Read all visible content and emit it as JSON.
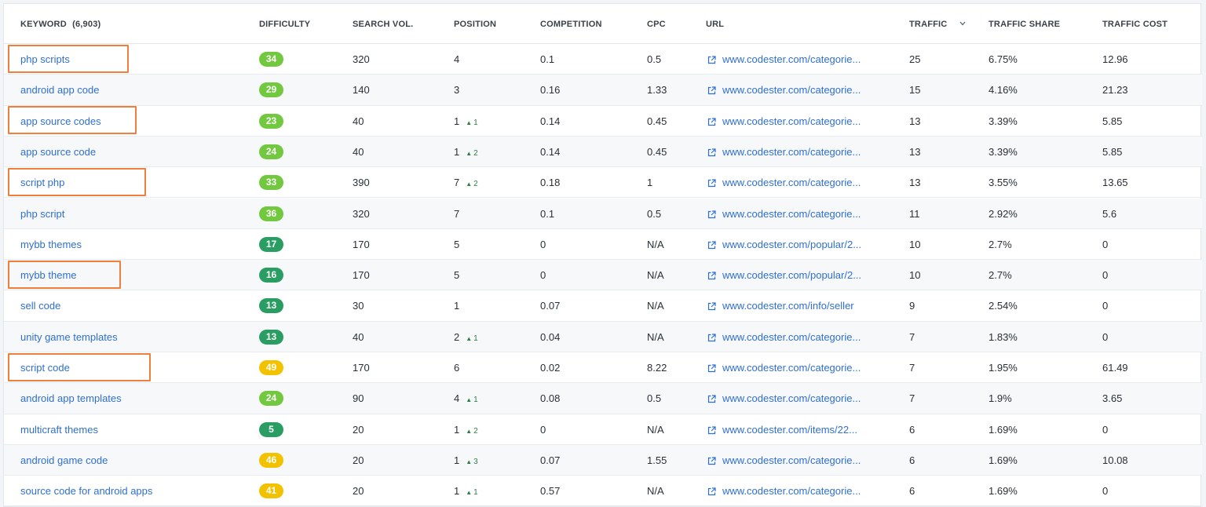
{
  "colors": {
    "keyword_link": "#2f6fd1",
    "difficulty_green_light": "#72c83f",
    "difficulty_green_dark": "#2a9d63",
    "difficulty_yellow": "#f2c200",
    "highlight_orange": "#f07f3c"
  },
  "columns": {
    "keyword": "KEYWORD",
    "keyword_count": "(6,903)",
    "difficulty": "DIFFICULTY",
    "search_vol": "SEARCH VOL.",
    "position": "POSITION",
    "competition": "COMPETITION",
    "cpc": "CPC",
    "url": "URL",
    "traffic": "TRAFFIC",
    "traffic_share": "TRAFFIC SHARE",
    "traffic_cost": "TRAFFIC COST"
  },
  "sort_icon": "chevron-down-icon",
  "rows": [
    {
      "keyword": "php scripts",
      "difficulty": "34",
      "diff_level": "light",
      "volume": "320",
      "position": "4",
      "change": "",
      "competition": "0.1",
      "cpc": "0.5",
      "url": "www.codester.com/categorie...",
      "traffic": "25",
      "share": "6.75%",
      "cost": "12.96",
      "highlighted": true
    },
    {
      "keyword": "android app code",
      "difficulty": "29",
      "diff_level": "light",
      "volume": "140",
      "position": "3",
      "change": "",
      "competition": "0.16",
      "cpc": "1.33",
      "url": "www.codester.com/categorie...",
      "traffic": "15",
      "share": "4.16%",
      "cost": "21.23",
      "highlighted": false
    },
    {
      "keyword": "app source codes",
      "difficulty": "23",
      "diff_level": "light",
      "volume": "40",
      "position": "1",
      "change": "1",
      "competition": "0.14",
      "cpc": "0.45",
      "url": "www.codester.com/categorie...",
      "traffic": "13",
      "share": "3.39%",
      "cost": "5.85",
      "highlighted": true
    },
    {
      "keyword": "app source code",
      "difficulty": "24",
      "diff_level": "light",
      "volume": "40",
      "position": "1",
      "change": "2",
      "competition": "0.14",
      "cpc": "0.45",
      "url": "www.codester.com/categorie...",
      "traffic": "13",
      "share": "3.39%",
      "cost": "5.85",
      "highlighted": false
    },
    {
      "keyword": "script php",
      "difficulty": "33",
      "diff_level": "light",
      "volume": "390",
      "position": "7",
      "change": "2",
      "competition": "0.18",
      "cpc": "1",
      "url": "www.codester.com/categorie...",
      "traffic": "13",
      "share": "3.55%",
      "cost": "13.65",
      "highlighted": true
    },
    {
      "keyword": "php script",
      "difficulty": "36",
      "diff_level": "light",
      "volume": "320",
      "position": "7",
      "change": "",
      "competition": "0.1",
      "cpc": "0.5",
      "url": "www.codester.com/categorie...",
      "traffic": "11",
      "share": "2.92%",
      "cost": "5.6",
      "highlighted": false
    },
    {
      "keyword": "mybb themes",
      "difficulty": "17",
      "diff_level": "dark",
      "volume": "170",
      "position": "5",
      "change": "",
      "competition": "0",
      "cpc": "N/A",
      "url": "www.codester.com/popular/2...",
      "traffic": "10",
      "share": "2.7%",
      "cost": "0",
      "highlighted": false
    },
    {
      "keyword": "mybb theme",
      "difficulty": "16",
      "diff_level": "dark",
      "volume": "170",
      "position": "5",
      "change": "",
      "competition": "0",
      "cpc": "N/A",
      "url": "www.codester.com/popular/2...",
      "traffic": "10",
      "share": "2.7%",
      "cost": "0",
      "highlighted": true
    },
    {
      "keyword": "sell code",
      "difficulty": "13",
      "diff_level": "dark",
      "volume": "30",
      "position": "1",
      "change": "",
      "competition": "0.07",
      "cpc": "N/A",
      "url": "www.codester.com/info/seller",
      "traffic": "9",
      "share": "2.54%",
      "cost": "0",
      "highlighted": false
    },
    {
      "keyword": "unity game templates",
      "difficulty": "13",
      "diff_level": "dark",
      "volume": "40",
      "position": "2",
      "change": "1",
      "competition": "0.04",
      "cpc": "N/A",
      "url": "www.codester.com/categorie...",
      "traffic": "7",
      "share": "1.83%",
      "cost": "0",
      "highlighted": false
    },
    {
      "keyword": "script code",
      "difficulty": "49",
      "diff_level": "yellow",
      "volume": "170",
      "position": "6",
      "change": "",
      "competition": "0.02",
      "cpc": "8.22",
      "url": "www.codester.com/categorie...",
      "traffic": "7",
      "share": "1.95%",
      "cost": "61.49",
      "highlighted": true
    },
    {
      "keyword": "android app templates",
      "difficulty": "24",
      "diff_level": "light",
      "volume": "90",
      "position": "4",
      "change": "1",
      "competition": "0.08",
      "cpc": "0.5",
      "url": "www.codester.com/categorie...",
      "traffic": "7",
      "share": "1.9%",
      "cost": "3.65",
      "highlighted": false
    },
    {
      "keyword": "multicraft themes",
      "difficulty": "5",
      "diff_level": "dark",
      "volume": "20",
      "position": "1",
      "change": "2",
      "competition": "0",
      "cpc": "N/A",
      "url": "www.codester.com/items/22...",
      "traffic": "6",
      "share": "1.69%",
      "cost": "0",
      "highlighted": false
    },
    {
      "keyword": "android game code",
      "difficulty": "46",
      "diff_level": "yellow",
      "volume": "20",
      "position": "1",
      "change": "3",
      "competition": "0.07",
      "cpc": "1.55",
      "url": "www.codester.com/categorie...",
      "traffic": "6",
      "share": "1.69%",
      "cost": "10.08",
      "highlighted": false
    },
    {
      "keyword": "source code for android apps",
      "difficulty": "41",
      "diff_level": "yellow",
      "volume": "20",
      "position": "1",
      "change": "1",
      "competition": "0.57",
      "cpc": "N/A",
      "url": "www.codester.com/categorie...",
      "traffic": "6",
      "share": "1.69%",
      "cost": "0",
      "highlighted": false
    }
  ]
}
